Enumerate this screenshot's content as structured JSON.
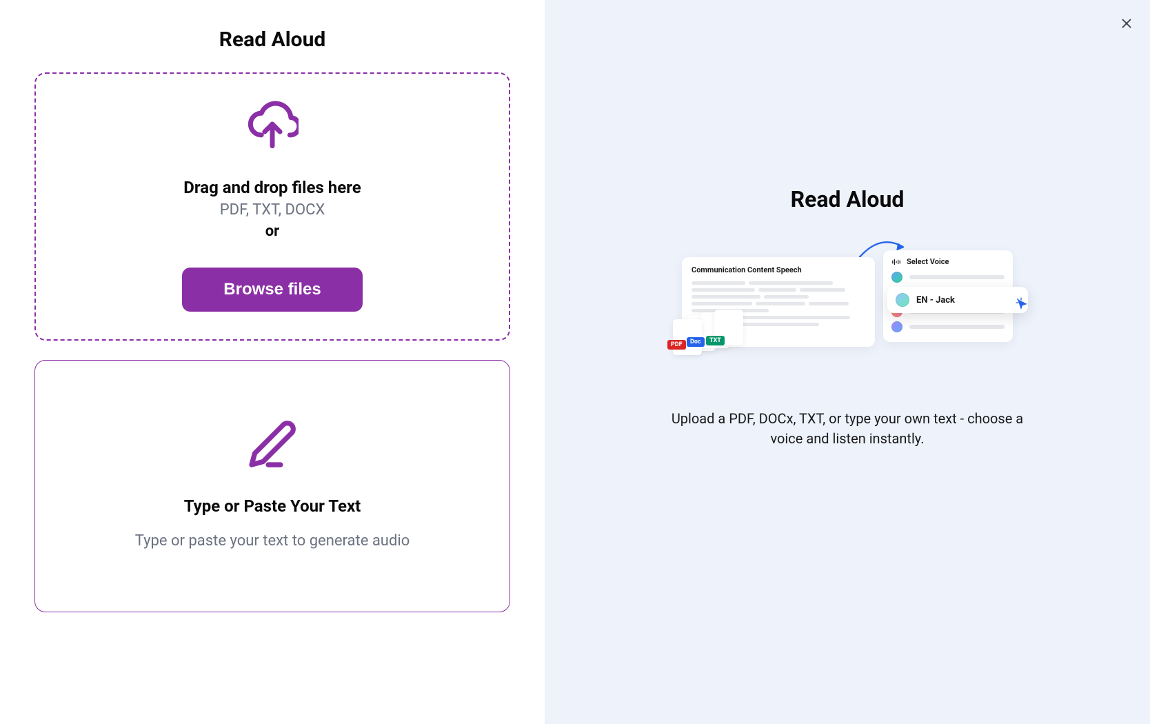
{
  "left": {
    "title": "Read Aloud",
    "dropzone": {
      "heading": "Drag and drop files here",
      "formats": "PDF, TXT, DOCX",
      "or": "or",
      "browse_button": "Browse files"
    },
    "text_card": {
      "heading": "Type or Paste Your Text",
      "subtext": "Type or paste your text to generate audio"
    }
  },
  "right": {
    "title": "Read Aloud",
    "illustration": {
      "doc_title": "Communication Content Speech",
      "voice_header": "Select Voice",
      "selected_voice": "EN - Jack",
      "badges": {
        "pdf": "PDF",
        "doc": "Doc",
        "txt": "TXT"
      }
    },
    "description": "Upload a PDF, DOCx, TXT, or type your own text - choose a voice and listen instantly."
  },
  "colors": {
    "accent": "#8b2fa6",
    "badge_pdf": "#dc2626",
    "badge_doc": "#2563eb",
    "badge_txt": "#059669"
  }
}
